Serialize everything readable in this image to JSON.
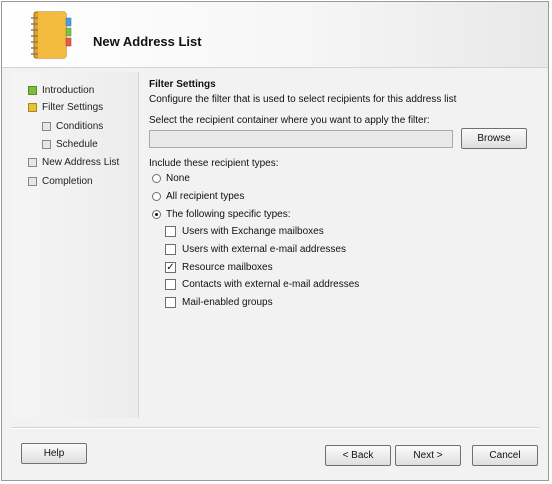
{
  "header": {
    "title": "New Address List"
  },
  "nav": {
    "items": [
      {
        "label": "Introduction",
        "state": "done"
      },
      {
        "label": "Filter Settings",
        "state": "current"
      },
      {
        "label": "Conditions",
        "state": "pending"
      },
      {
        "label": "Schedule",
        "state": "pending"
      },
      {
        "label": "New Address List",
        "state": "pending"
      },
      {
        "label": "Completion",
        "state": "pending"
      }
    ]
  },
  "filter": {
    "section_title": "Filter Settings",
    "description": "Configure the filter that is used to select recipients for this address list",
    "container_label": "Select the recipient container where you want to apply the filter:",
    "container_value": "",
    "browse_label": "Browse",
    "recipient_types_label": "Include these recipient types:",
    "radios": [
      {
        "label": "None",
        "selected": false
      },
      {
        "label": "All recipient types",
        "selected": false
      },
      {
        "label": "The following specific types:",
        "selected": true
      }
    ],
    "checks": [
      {
        "label": "Users with Exchange mailboxes",
        "checked": false
      },
      {
        "label": "Users with external e-mail addresses",
        "checked": false
      },
      {
        "label": "Resource mailboxes",
        "checked": true
      },
      {
        "label": "Contacts with external e-mail addresses",
        "checked": false
      },
      {
        "label": "Mail-enabled groups",
        "checked": false
      }
    ]
  },
  "footer": {
    "help_label": "Help",
    "back_label": "< Back",
    "next_label": "Next >",
    "cancel_label": "Cancel"
  },
  "colors": {
    "done": "#7bbd3c",
    "current": "#e6c23a",
    "pending": "#e6e6e6"
  }
}
